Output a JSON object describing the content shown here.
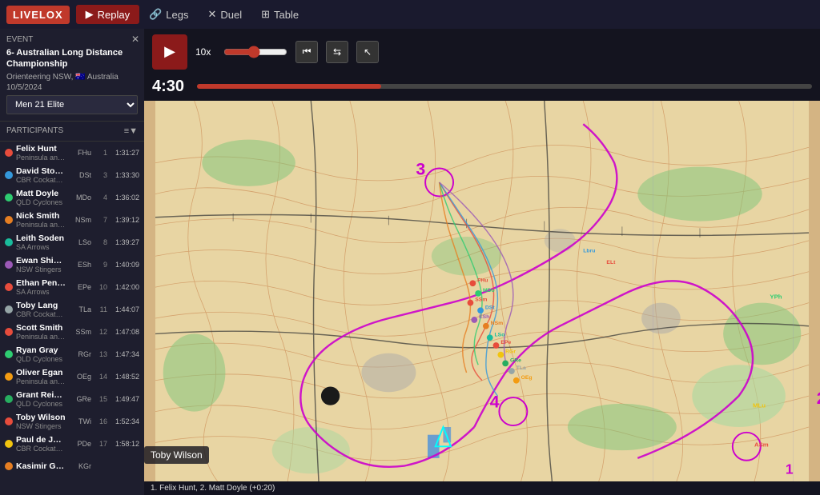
{
  "app": {
    "logo": "LIVELOX",
    "nav": [
      {
        "id": "replay",
        "label": "Replay",
        "icon": "▶",
        "active": true
      },
      {
        "id": "legs",
        "label": "Legs",
        "icon": "🔗"
      },
      {
        "id": "duel",
        "label": "Duel",
        "icon": "✕"
      },
      {
        "id": "table",
        "label": "Table",
        "icon": "⊞"
      }
    ]
  },
  "event": {
    "label": "Event",
    "title": "6- Australian Long Distance Championship",
    "org": "Orienteering NSW,",
    "country": "Australia",
    "date": "10/5/2024",
    "category": "Men 21 Elite"
  },
  "participants_header": "Participants",
  "participants": [
    {
      "name": "Felix Hunt",
      "abbr": "FHu",
      "team": "Peninsula and ...",
      "rank": "1",
      "time": "1:31:27",
      "color": "#e74c3c"
    },
    {
      "name": "David Stocks",
      "abbr": "DSt",
      "team": "CBR Cockatoos",
      "rank": "3",
      "time": "1:33:30",
      "color": "#3498db"
    },
    {
      "name": "Matt Doyle",
      "abbr": "MDo",
      "team": "QLD Cyclones",
      "rank": "4",
      "time": "1:36:02",
      "color": "#2ecc71"
    },
    {
      "name": "Nick Smith",
      "abbr": "NSm",
      "team": "Peninsula and ...",
      "rank": "7",
      "time": "1:39:12",
      "color": "#e67e22"
    },
    {
      "name": "Leith Soden",
      "abbr": "LSo",
      "team": "SA Arrows",
      "rank": "8",
      "time": "1:39:27",
      "color": "#1abc9c"
    },
    {
      "name": "Ewan Shingler",
      "abbr": "ESh",
      "team": "NSW Stingers",
      "rank": "9",
      "time": "1:40:09",
      "color": "#9b59b6"
    },
    {
      "name": "Ethan Penck",
      "abbr": "EPe",
      "team": "SA Arrows",
      "rank": "10",
      "time": "1:42:00",
      "color": "#e74c3c"
    },
    {
      "name": "Toby Lang",
      "abbr": "TLa",
      "team": "CBR Cockatoos",
      "rank": "11",
      "time": "1:44:07",
      "color": "#95a5a6"
    },
    {
      "name": "Scott Smith",
      "abbr": "SSm",
      "team": "Peninsula and ...",
      "rank": "12",
      "time": "1:47:08",
      "color": "#e74c3c"
    },
    {
      "name": "Ryan Gray",
      "abbr": "RGr",
      "team": "QLD Cyclones",
      "rank": "13",
      "time": "1:47:34",
      "color": "#2ecc71"
    },
    {
      "name": "Oliver Egan",
      "abbr": "OEg",
      "team": "Peninsula and ...",
      "rank": "14",
      "time": "1:48:52",
      "color": "#f39c12"
    },
    {
      "name": "Grant Reinbott",
      "abbr": "GRe",
      "team": "QLD Cyclones",
      "rank": "15",
      "time": "1:49:47",
      "color": "#27ae60"
    },
    {
      "name": "Toby Wilson",
      "abbr": "TWi",
      "team": "NSW Stingers",
      "rank": "16",
      "time": "1:52:34",
      "color": "#e74c3c"
    },
    {
      "name": "Paul de Jongh",
      "abbr": "PDe",
      "team": "CBR Cockatoos",
      "rank": "17",
      "time": "1:58:12",
      "color": "#f1c40f"
    },
    {
      "name": "Kasimir Gregory",
      "abbr": "KGr",
      "team": "",
      "rank": "",
      "time": "",
      "color": "#e67e22"
    }
  ],
  "controls": {
    "speed": "10x",
    "time": "4:30",
    "play_icon": "▶",
    "skip_start_icon": "⏮",
    "skip_back_icon": "◀◀",
    "skip_fwd_icon": "▶▶"
  },
  "status_bar": {
    "text": "1. Felix Hunt, 2. Matt Doyle (+0:20)"
  },
  "bottom_participant": "Toby Wilson"
}
